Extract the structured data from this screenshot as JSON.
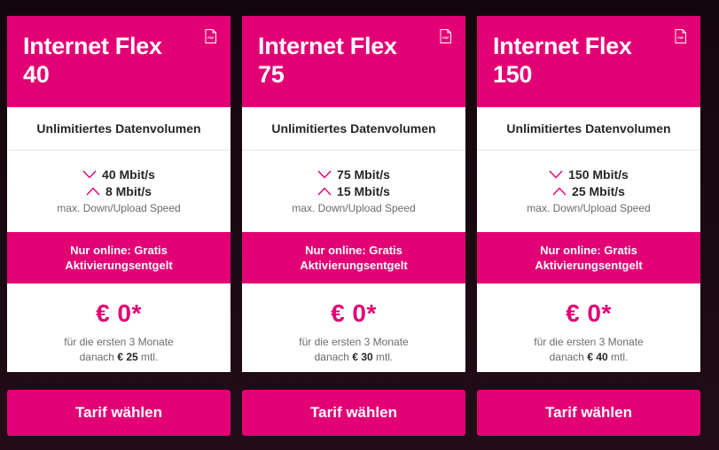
{
  "colors": {
    "magenta": "#e20074",
    "text_dark": "#262626",
    "text_muted": "#6b6b6b"
  },
  "icons": {
    "pdf": "pdf-icon",
    "download": "chevron-down-icon",
    "upload": "chevron-up-icon"
  },
  "common": {
    "volume": "Unlimitiertes Datenvolumen",
    "speed_caption": "max. Down/Upload Speed",
    "promo_line1": "Nur online: Gratis",
    "promo_line2": "Aktivierungsentgelt",
    "price": "€ 0*",
    "price_note_line1": "für die ersten 3 Monate",
    "price_note_prefix": "danach",
    "price_note_suffix": "mtl.",
    "cta": "Tarif wählen"
  },
  "plans": [
    {
      "name_line1": "Internet Flex",
      "name_line2": "40",
      "down": "40 Mbit/s",
      "up": "8 Mbit/s",
      "after_price": "€ 25"
    },
    {
      "name_line1": "Internet Flex",
      "name_line2": "75",
      "down": "75 Mbit/s",
      "up": "15 Mbit/s",
      "after_price": "€ 30"
    },
    {
      "name_line1": "Internet Flex",
      "name_line2": "150",
      "down": "150 Mbit/s",
      "up": "25 Mbit/s",
      "after_price": "€ 40"
    }
  ]
}
